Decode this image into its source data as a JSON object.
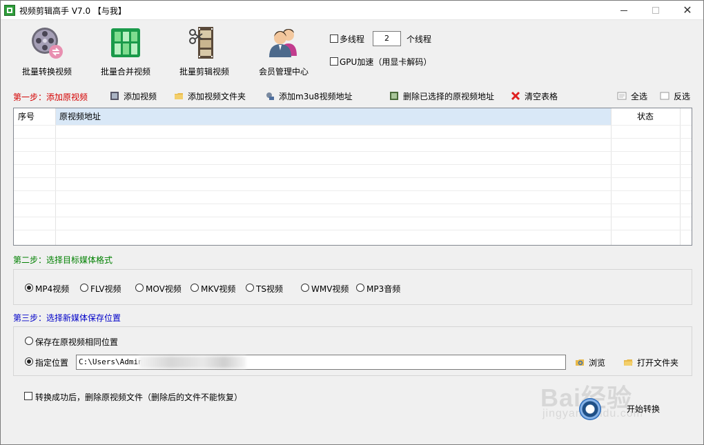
{
  "window": {
    "title": "视频剪辑高手 V7.0  【与我】",
    "controls": {
      "minimize": "—",
      "maximize": "□",
      "close": "✕"
    }
  },
  "toolbar": [
    {
      "label": "批量转换视频",
      "icon": "film-reel-icon"
    },
    {
      "label": "批量合并视频",
      "icon": "merge-grid-icon"
    },
    {
      "label": "批量剪辑视频",
      "icon": "film-scissors-icon"
    },
    {
      "label": "会员管理中心",
      "icon": "members-icon"
    }
  ],
  "options": {
    "multithread_label": "多线程",
    "multithread_checked": false,
    "thread_count": "2",
    "thread_unit": "个线程",
    "gpu_label": "GPU加速（用显卡解码）",
    "gpu_checked": false
  },
  "step1": {
    "label": "第一步：添加原视频",
    "color": "#d40000",
    "actions": {
      "add_video": "添加视频",
      "add_folder": "添加视频文件夹",
      "add_m3u8": "添加m3u8视频地址",
      "delete_selected": "删除已选择的原视频地址",
      "clear_table": "清空表格",
      "select_all": "全选",
      "invert": "反选"
    },
    "table": {
      "columns": [
        "序号",
        "原视频地址",
        "状态"
      ],
      "rows": []
    }
  },
  "step2": {
    "label": "第二步：选择目标媒体格式",
    "color": "#008000",
    "formats": [
      {
        "label": "MP4视频",
        "selected": true
      },
      {
        "label": "FLV视频",
        "selected": false
      },
      {
        "label": "MOV视频",
        "selected": false
      },
      {
        "label": "MKV视频",
        "selected": false
      },
      {
        "label": "TS视频",
        "selected": false
      },
      {
        "label": "WMV视频",
        "selected": false
      },
      {
        "label": "MP3音频",
        "selected": false
      }
    ]
  },
  "step3": {
    "label": "第三步：选择新媒体保存位置",
    "color": "#0000c8",
    "same_location_label": "保存在原视频相同位置",
    "same_location_selected": false,
    "custom_location_label": "指定位置",
    "custom_location_selected": true,
    "path_value": "C:\\Users\\Admin",
    "browse_label": "浏览",
    "open_folder_label": "打开文件夹"
  },
  "footer": {
    "delete_after_label": "转换成功后，删除原视频文件（删除后的文件不能恢复）",
    "delete_after_checked": false,
    "start_label": "开始转换"
  },
  "watermark": {
    "logo": "Bai经验",
    "sub": "jingyan.baidu.com"
  }
}
